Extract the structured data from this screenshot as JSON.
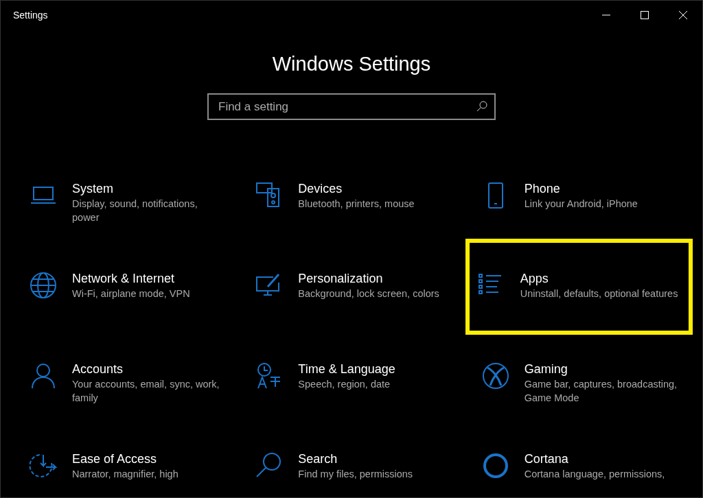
{
  "window": {
    "title": "Settings"
  },
  "heading": "Windows Settings",
  "search": {
    "placeholder": "Find a setting"
  },
  "categories": [
    {
      "title": "System",
      "description": "Display, sound, notifications, power",
      "highlighted": false
    },
    {
      "title": "Devices",
      "description": "Bluetooth, printers, mouse",
      "highlighted": false
    },
    {
      "title": "Phone",
      "description": "Link your Android, iPhone",
      "highlighted": false
    },
    {
      "title": "Network & Internet",
      "description": "Wi-Fi, airplane mode, VPN",
      "highlighted": false
    },
    {
      "title": "Personalization",
      "description": "Background, lock screen, colors",
      "highlighted": false
    },
    {
      "title": "Apps",
      "description": "Uninstall, defaults, optional features",
      "highlighted": true
    },
    {
      "title": "Accounts",
      "description": "Your accounts, email, sync, work, family",
      "highlighted": false
    },
    {
      "title": "Time & Language",
      "description": "Speech, region, date",
      "highlighted": false
    },
    {
      "title": "Gaming",
      "description": "Game bar, captures, broadcasting, Game Mode",
      "highlighted": false
    },
    {
      "title": "Ease of Access",
      "description": "Narrator, magnifier, high",
      "highlighted": false
    },
    {
      "title": "Search",
      "description": "Find my files, permissions",
      "highlighted": false
    },
    {
      "title": "Cortana",
      "description": "Cortana language, permissions,",
      "highlighted": false
    }
  ]
}
